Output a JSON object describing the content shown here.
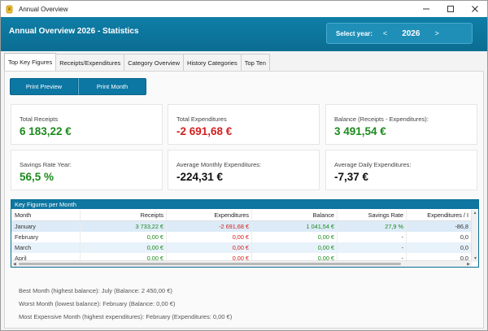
{
  "window": {
    "title": "Annual Overview"
  },
  "header": {
    "heading": "Annual Overview  2026 - Statistics"
  },
  "year_selector": {
    "label": "Select year:",
    "prev": "<",
    "value": "2026",
    "next": ">"
  },
  "tabs": [
    {
      "label": "Top Key Figures",
      "active": true
    },
    {
      "label": "Receipts/Expenditures",
      "active": false
    },
    {
      "label": "Category Overview",
      "active": false
    },
    {
      "label": "History Categories",
      "active": false
    },
    {
      "label": "Top Ten",
      "active": false
    }
  ],
  "buttons": {
    "print_preview": "Print Preview",
    "print_month": "Print Month"
  },
  "cards": {
    "total_receipts": {
      "label": "Total Receipts",
      "value": "6 183,22 €"
    },
    "total_expenditures": {
      "label": "Total Expenditures",
      "value": "-2 691,68 €"
    },
    "balance": {
      "label": "Balance (Receipts - Expenditures):",
      "value": "3 491,54 €"
    },
    "savings_rate": {
      "label": "Savings Rate Year:",
      "value": "56,5 %"
    },
    "avg_monthly": {
      "label": "Average Monthly Expenditures:",
      "value": "-224,31 €"
    },
    "avg_daily": {
      "label": "Average Daily Expenditures:",
      "value": "-7,37 €"
    }
  },
  "monthly": {
    "title": "Key Figures per Month",
    "columns": [
      "Month",
      "Receipts",
      "Expenditures",
      "Balance",
      "Savings Rate",
      "Expenditures / I"
    ],
    "rows": [
      [
        "January",
        "3 733,22 €",
        "-2 691,68 €",
        "1 041,54 €",
        "27,9 %",
        "-86,8"
      ],
      [
        "February",
        "0,00 €",
        "0,00 €",
        "0,00 €",
        "-",
        "0,0"
      ],
      [
        "March",
        "0,00 €",
        "0,00 €",
        "0,00 €",
        "-",
        "0,0"
      ],
      [
        "April",
        "0,00 €",
        "0,00 €",
        "0,00 €",
        "-",
        "0,0"
      ]
    ]
  },
  "notes": {
    "best_month": "Best Month (highest balance): July (Balance: 2 450,00 €)",
    "worst_month": "Worst Month (lowest balance): February (Balance: 0,00 €)",
    "most_expensive": "Most Expensive Month (highest expenditures): February (Expenditures: 0,00 €)"
  },
  "colors": {
    "header": "#0b6d92",
    "positive": "#1c8a1c",
    "negative": "#d42020",
    "row_alt": "#e8f2fa"
  },
  "icons": [
    "app-icon",
    "minimize-icon",
    "maximize-icon",
    "close-icon",
    "chevron-left-icon",
    "chevron-right-icon"
  ]
}
